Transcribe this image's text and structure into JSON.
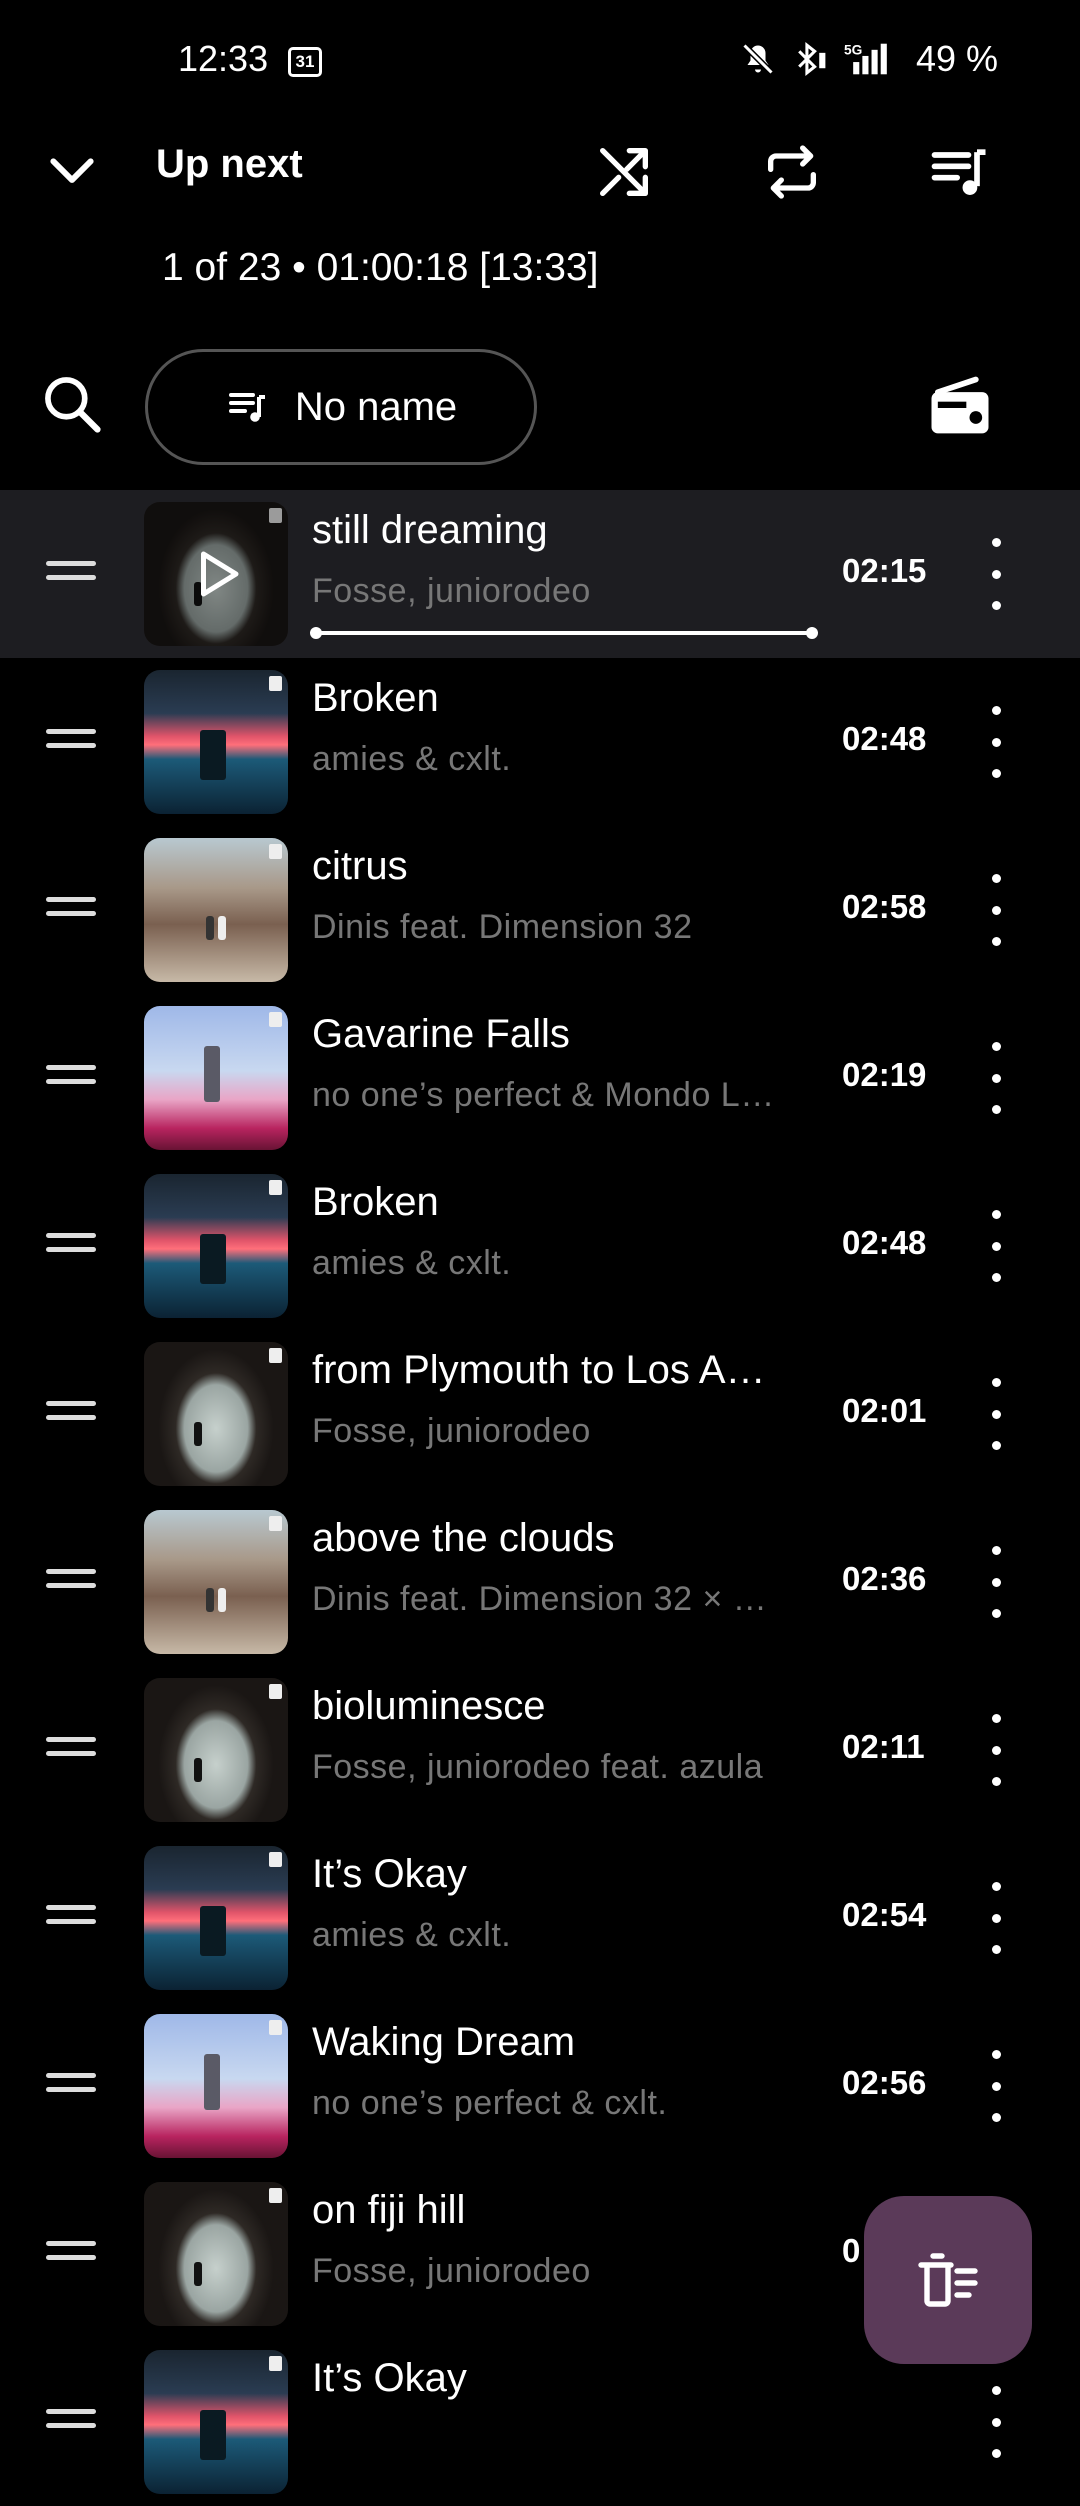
{
  "status_bar": {
    "time": "12:33",
    "calendar_day": "31",
    "battery": "49 %",
    "network": "5G"
  },
  "header": {
    "title": "Up next",
    "subtitle": "1 of 23 • 01:00:18 [13:33]",
    "icons": [
      "chevron-down-icon",
      "shuffle-icon",
      "repeat-icon",
      "queue-music-icon"
    ]
  },
  "toolbar": {
    "queue_name": "No name",
    "icons": [
      "search-icon",
      "queue-icon",
      "radio-icon"
    ]
  },
  "tracks": [
    {
      "title": "still dreaming",
      "artist": "Fosse, juniorodeo",
      "duration": "02:15",
      "art": "arch",
      "active": true
    },
    {
      "title": "Broken",
      "artist": "amies & cxlt.",
      "duration": "02:48",
      "art": "cliff"
    },
    {
      "title": "citrus",
      "artist": "Dinis feat. Dimension 32",
      "duration": "02:58",
      "art": "villa"
    },
    {
      "title": "Gavarine Falls",
      "artist": "no one’s perfect & Mondo L…",
      "duration": "02:19",
      "art": "mill"
    },
    {
      "title": "Broken",
      "artist": "amies & cxlt.",
      "duration": "02:48",
      "art": "cliff"
    },
    {
      "title": "from Plymouth to Los A…",
      "artist": "Fosse, juniorodeo",
      "duration": "02:01",
      "art": "arch"
    },
    {
      "title": "above the clouds",
      "artist": "Dinis feat. Dimension 32 × …",
      "duration": "02:36",
      "art": "villa"
    },
    {
      "title": "bioluminesce",
      "artist": "Fosse, juniorodeo feat. azula",
      "duration": "02:11",
      "art": "arch"
    },
    {
      "title": "It’s Okay",
      "artist": "amies & cxlt.",
      "duration": "02:54",
      "art": "cliff"
    },
    {
      "title": "Waking Dream",
      "artist": "no one’s perfect & cxlt.",
      "duration": "02:56",
      "art": "mill"
    },
    {
      "title": "on fiji hill",
      "artist": "Fosse, juniorodeo",
      "duration": "0",
      "art": "arch"
    },
    {
      "title": "It’s Okay",
      "artist": "",
      "duration": "",
      "art": "cliff"
    }
  ],
  "now_playing_progress": 1.0,
  "fab": {
    "icon": "clear-queue-icon",
    "color": "#5b3a59"
  }
}
